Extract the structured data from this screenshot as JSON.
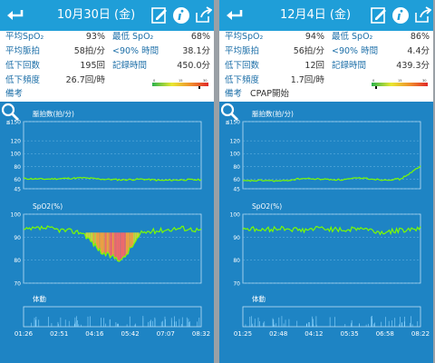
{
  "colors": {
    "header": "#1f9ed8",
    "chart_bg": "#1e84c4",
    "trace": "#7cfc00",
    "label": "#1d6fa8"
  },
  "panels": [
    {
      "date": "10月30日 (金)",
      "stats": {
        "avg_spo2_label": "平均SpO₂",
        "avg_spo2": "93%",
        "min_spo2_label": "最低 SpO₂",
        "min_spo2": "68%",
        "avg_pulse_label": "平均脈拍",
        "avg_pulse": "58拍/分",
        "below90_label": "<90% 時間",
        "below90": "38.1分",
        "drops_label": "低下回数",
        "drops": "195回",
        "record_label": "記録時間",
        "record": "450.0分",
        "freq_label": "低下頻度",
        "freq": "26.7回/時",
        "note_label": "備考",
        "note": ""
      },
      "colorbar_ticks": [
        "0",
        "15",
        "30"
      ],
      "chart_data": [
        {
          "type": "line",
          "title": "脈拍数(拍/分)",
          "ylim": [
            45,
            150
          ],
          "yticks": [
            "≦150",
            "120",
            "100",
            "80",
            "60",
            "45"
          ],
          "x": [
            "01:26",
            "02:51",
            "04:16",
            "05:42",
            "07:07",
            "08:32"
          ],
          "values": [
            61,
            60,
            61,
            62,
            60,
            59,
            60,
            58,
            59,
            59
          ]
        },
        {
          "type": "area",
          "title": "SpO2(%)",
          "ylim": [
            70,
            100
          ],
          "yticks": [
            "100",
            "90",
            "80",
            "70"
          ],
          "x": [
            "01:26",
            "02:51",
            "04:16",
            "05:42",
            "07:07",
            "08:32"
          ],
          "values": [
            93,
            94,
            93,
            92,
            83,
            80,
            92,
            93,
            94,
            93
          ]
        },
        {
          "type": "bar",
          "title": "体動",
          "x": [
            "01:26",
            "02:51",
            "04:16",
            "05:42",
            "07:07",
            "08:32"
          ]
        }
      ],
      "x_labels": [
        "01:26",
        "02:51",
        "04:16",
        "05:42",
        "07:07",
        "08:32"
      ]
    },
    {
      "date": "12月4日 (金)",
      "stats": {
        "avg_spo2_label": "平均SpO₂",
        "avg_spo2": "94%",
        "min_spo2_label": "最低 SpO₂",
        "min_spo2": "86%",
        "avg_pulse_label": "平均脈拍",
        "avg_pulse": "56拍/分",
        "below90_label": "<90% 時間",
        "below90": "4.4分",
        "drops_label": "低下回数",
        "drops": "12回",
        "record_label": "記録時間",
        "record": "439.3分",
        "freq_label": "低下頻度",
        "freq": "1.7回/時",
        "note_label": "備考",
        "note": "CPAP開始"
      },
      "colorbar_ticks": [
        "0",
        "15",
        "30"
      ],
      "chart_data": [
        {
          "type": "line",
          "title": "脈拍数(拍/分)",
          "ylim": [
            45,
            150
          ],
          "yticks": [
            "≦150",
            "120",
            "100",
            "80",
            "60",
            "45"
          ],
          "x": [
            "01:25",
            "02:48",
            "04:12",
            "05:35",
            "06:58",
            "08:22"
          ],
          "values": [
            57,
            58,
            57,
            61,
            60,
            59,
            62,
            59,
            60,
            80
          ]
        },
        {
          "type": "line",
          "title": "SpO2(%)",
          "ylim": [
            70,
            100
          ],
          "yticks": [
            "100",
            "90",
            "80",
            "70"
          ],
          "x": [
            "01:25",
            "02:48",
            "04:12",
            "05:35",
            "06:58",
            "08:22"
          ],
          "values": [
            94,
            93,
            94,
            93,
            94,
            93,
            94,
            92,
            93,
            94
          ]
        },
        {
          "type": "bar",
          "title": "体動",
          "x": [
            "01:25",
            "02:48",
            "04:12",
            "05:35",
            "06:58",
            "08:22"
          ]
        }
      ],
      "x_labels": [
        "01:25",
        "02:48",
        "04:12",
        "05:35",
        "06:58",
        "08:22"
      ]
    }
  ]
}
